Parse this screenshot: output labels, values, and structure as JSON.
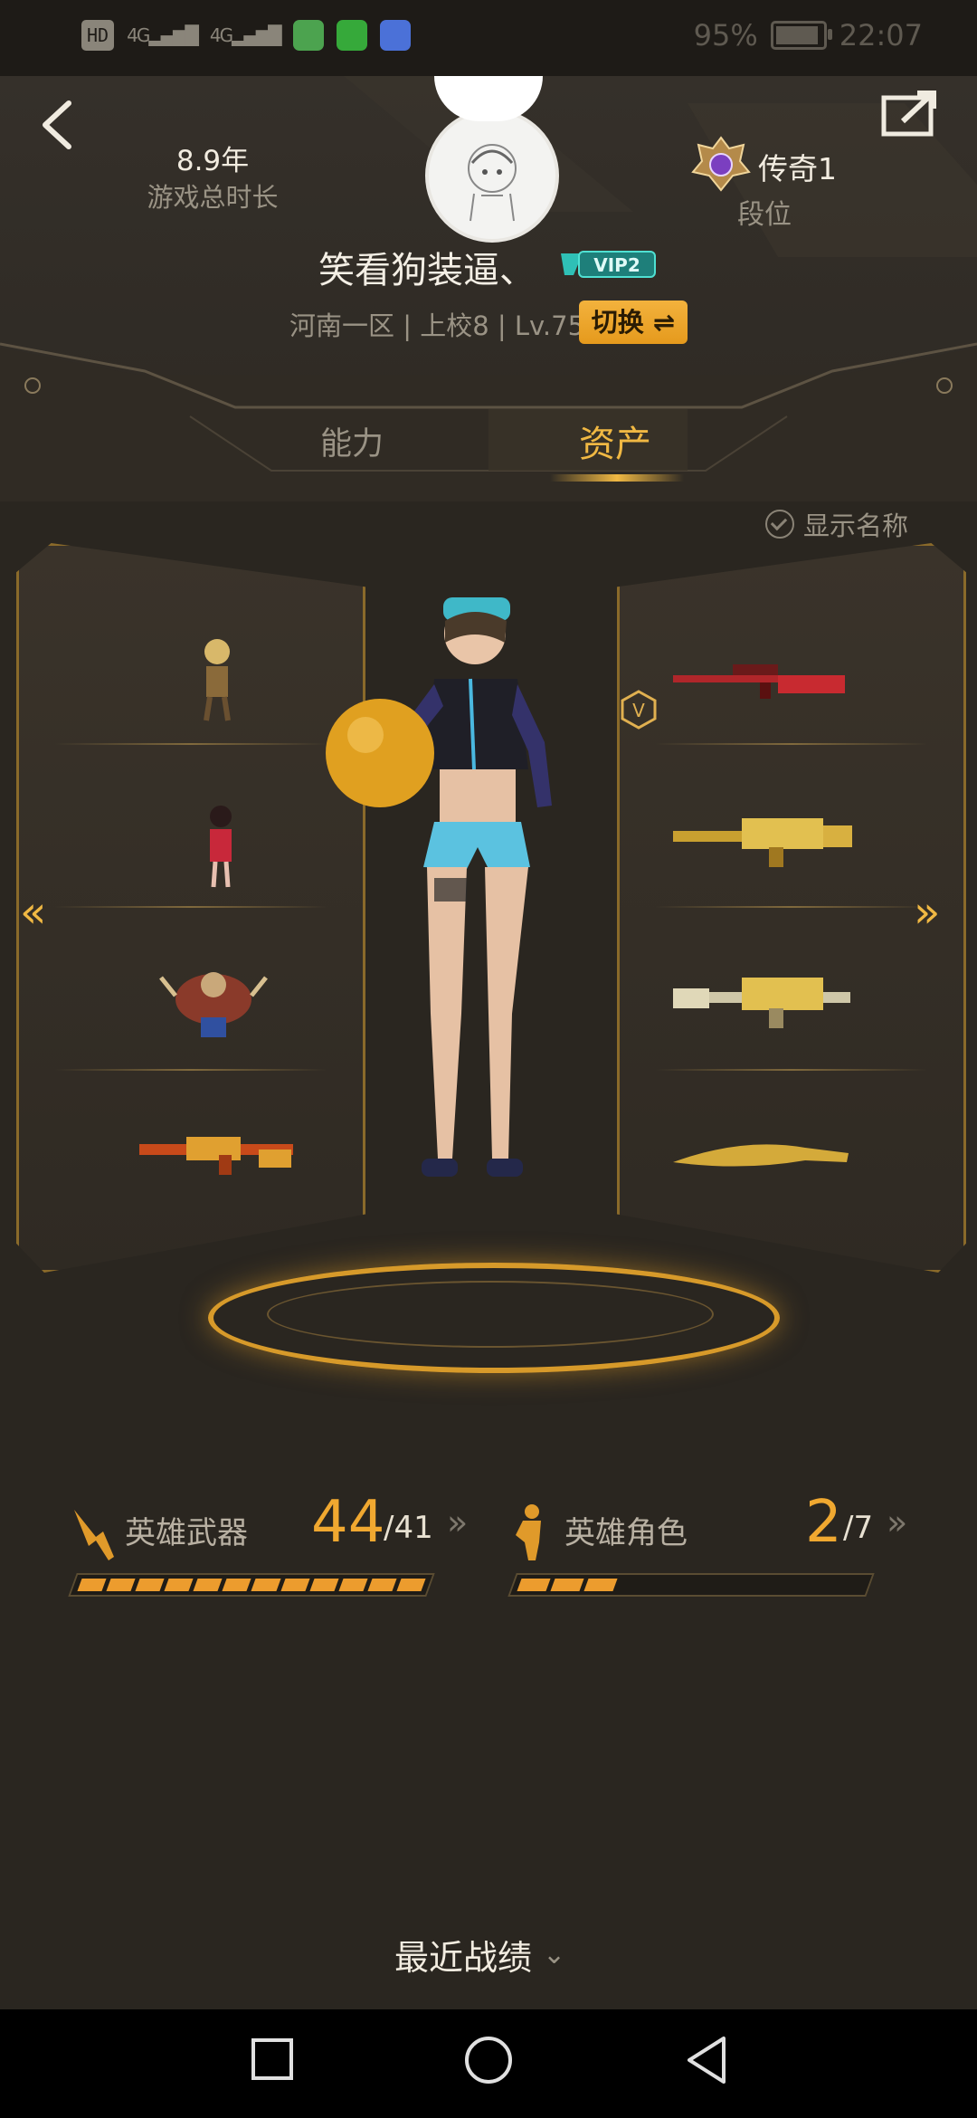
{
  "status_bar": {
    "hd": "HD",
    "net1": "4G",
    "net2": "4G",
    "battery_text": "95%",
    "battery_level": 0.95,
    "time": "22:07",
    "apps": [
      "wechat-app-icon",
      "iqiyi-app-icon",
      "browser-app-icon"
    ]
  },
  "header": {
    "play_duration": "8.9年",
    "play_duration_label": "游戏总时长",
    "rank": "传奇1",
    "rank_label": "段位",
    "nickname": "笑看狗装逼、",
    "vip": "VIP2",
    "info": "河南一区 | 上校8 | Lv.75",
    "switch": "切换 ⇌"
  },
  "tabs": {
    "ability": "能力",
    "assets": "资产"
  },
  "showcase": {
    "show_names": "显示名称",
    "left_items": [
      "hero-character-1",
      "hero-character-2",
      "hero-character-3",
      "hero-weapon-rifle"
    ],
    "right_items": [
      "sniper-rifle",
      "golden-rifle-1",
      "golden-rifle-2",
      "golden-knife"
    ]
  },
  "stats": {
    "weapons": {
      "label": "英雄武器",
      "owned": "44",
      "total": "/41",
      "fill_segments": 12,
      "total_segments": 12
    },
    "characters": {
      "label": "英雄角色",
      "owned": "2",
      "total": "/7",
      "fill_segments": 3,
      "total_segments": 12
    }
  },
  "recent": {
    "label": "最近战绩"
  },
  "colors": {
    "accent": "#f0b843",
    "orange": "#ec9c2e",
    "bg": "#2a2620"
  }
}
